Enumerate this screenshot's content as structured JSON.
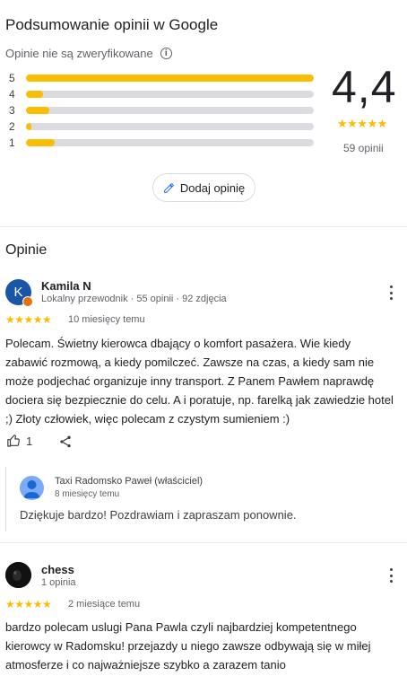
{
  "summary": {
    "title": "Podsumowanie opinii w Google",
    "unverified_note": "Opinie nie są zweryfikowane",
    "info_icon": "info-icon",
    "distribution": [
      {
        "label": "5",
        "fraction": 1.0
      },
      {
        "label": "4",
        "fraction": 0.06
      },
      {
        "label": "3",
        "fraction": 0.08
      },
      {
        "label": "2",
        "fraction": 0.02
      },
      {
        "label": "1",
        "fraction": 0.1
      }
    ],
    "rating": "4,4",
    "stars": "★★★★★",
    "star_fill": 0.88,
    "review_count": "59 opinii",
    "add_review_label": "Dodaj opinię",
    "star_color": "#fbbc04"
  },
  "reviews_section": {
    "title": "Opinie"
  },
  "reviews": [
    {
      "avatar_letter": "K",
      "avatar_color": "#1a56a8",
      "name": "Kamila N",
      "meta": "Lokalny przewodnik · 55 opinii · 92 zdjęcia",
      "stars": "★★★★★",
      "time": "10 miesięcy temu",
      "text_lines": [
        "Polecam. Świetny kierowca dbający o komfort pasażera. Wie kiedy",
        "zabawić rozmową, a kiedy pomilczeć. Zawsze na czas, a kiedy sam nie",
        "może podjechać organizuje inny transport. Z Panem Pawłem naprawdę",
        "dociera się bezpiecznie do celu. A i poratuje, np. farelką jak zawiedzie hotel",
        ";) Złoty człowiek, więc polecam z czystym sumieniem :)"
      ],
      "likes": "1",
      "reply": {
        "name": "Taxi Radomsko Paweł (właściciel)",
        "time": "8 miesięcy temu",
        "text": "Dziękuje bardzo! Pozdrawiam i zapraszam ponownie."
      }
    },
    {
      "avatar_color": "#111111",
      "name": "chess",
      "meta": "1 opinia",
      "stars": "★★★★★",
      "time": "2 miesiące temu",
      "text_lines": [
        "bardzo polecam uslugi Pana Pawla czyli najbardziej kompetentnego",
        "kierowcy w Radomsku! przejazdy u niego zawsze odbywają się w miłej",
        "atmosferze i co najważniejsze szybko a zarazem tanio"
      ]
    }
  ]
}
